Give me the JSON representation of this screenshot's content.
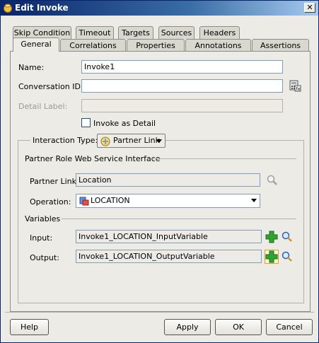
{
  "window": {
    "title": "Edit Invoke",
    "close_glyph": "✕"
  },
  "tabs_row1": [
    {
      "label": "Skip Condition"
    },
    {
      "label": "Timeout"
    },
    {
      "label": "Targets"
    },
    {
      "label": "Sources"
    },
    {
      "label": "Headers"
    }
  ],
  "tabs_row2": [
    {
      "label": "General",
      "active": true
    },
    {
      "label": "Correlations"
    },
    {
      "label": "Properties"
    },
    {
      "label": "Annotations"
    },
    {
      "label": "Assertions"
    }
  ],
  "general": {
    "name_label": "Name:",
    "name_value": "Invoke1",
    "conversation_label": "Conversation ID:",
    "conversation_value": "",
    "detail_label": "Detail Label:",
    "detail_value": "",
    "invoke_as_detail": "Invoke as Detail",
    "interaction_type_label": "Interaction Type:",
    "interaction_type_value": "Partner Link",
    "partner_role_title": "Partner Role Web Service Interface",
    "partner_link_label": "Partner Link:",
    "partner_link_value": "Location",
    "operation_label": "Operation:",
    "operation_value": "LOCATION",
    "variables_title": "Variables",
    "input_label": "Input:",
    "input_value": "Invoke1_LOCATION_InputVariable",
    "output_label": "Output:",
    "output_value": "Invoke1_LOCATION_OutputVariable"
  },
  "buttons": {
    "help": "Help",
    "apply": "Apply",
    "ok": "OK",
    "cancel": "Cancel"
  },
  "colors": {
    "titlebar": "#0a246a",
    "dialog_bg": "#ecebe5",
    "add_icon": "#2fa52f",
    "search_icon": "#2a62b5"
  }
}
